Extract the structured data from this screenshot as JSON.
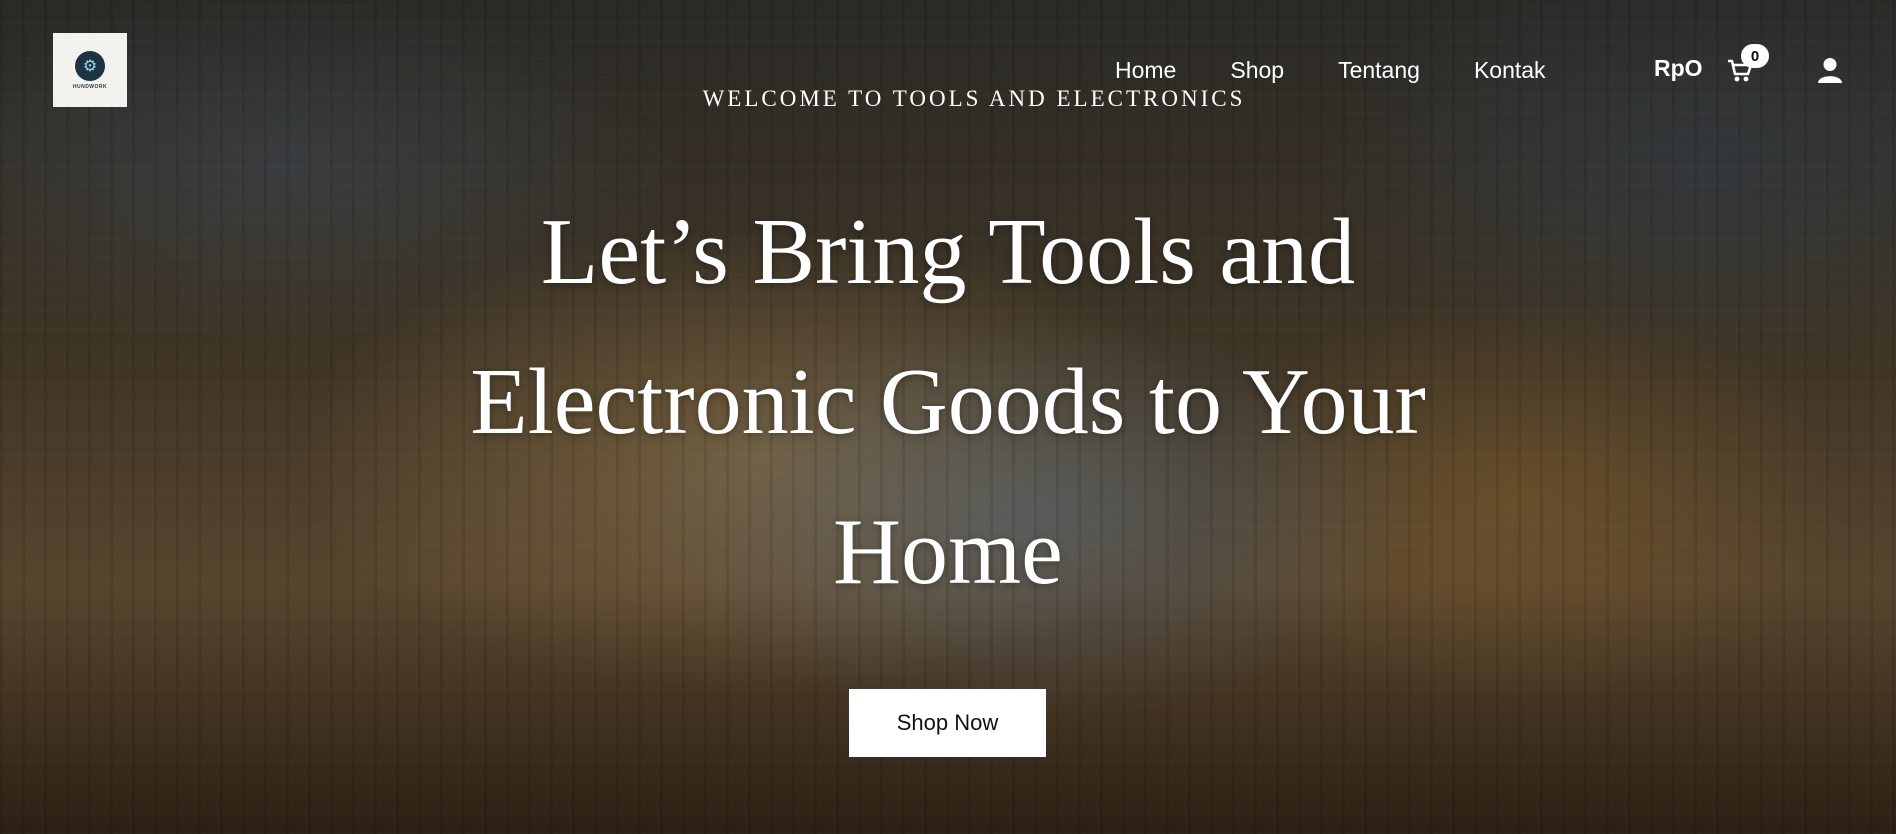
{
  "logo": {
    "text": "HUNDWORK"
  },
  "nav": {
    "items": [
      "Home",
      "Shop",
      "Tentang",
      "Kontak"
    ]
  },
  "header": {
    "currency": "RpO",
    "cart_count": "0"
  },
  "icons": {
    "cart": "shopping-cart-icon",
    "account": "user-icon"
  },
  "hero": {
    "eyebrow": "WELCOME TO TOOLS AND ELECTRONICS",
    "headline": "Let’s Bring Tools and Electronic Goods to Your Home",
    "cta": "Shop Now"
  }
}
